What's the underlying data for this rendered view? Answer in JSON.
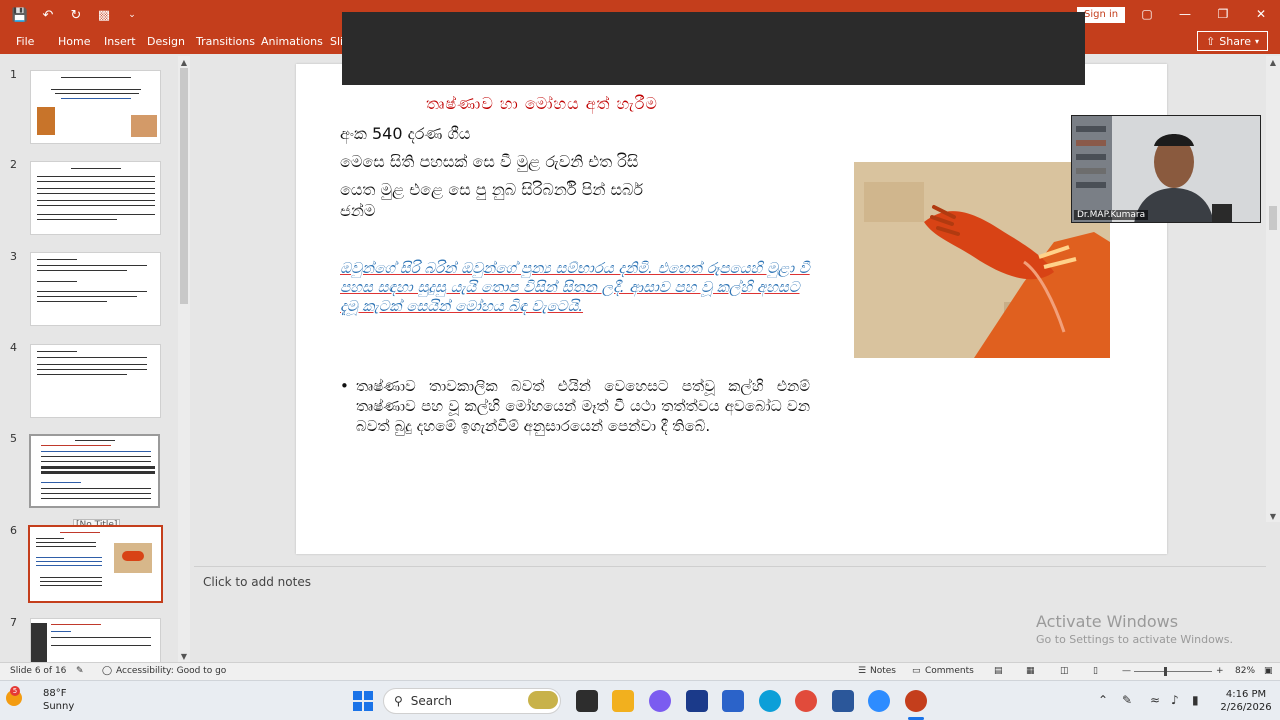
{
  "window": {
    "title_label": "Sign in",
    "share_label": "Share"
  },
  "ribbon": {
    "tabs": [
      {
        "label": "File"
      },
      {
        "label": "Home"
      },
      {
        "label": "Insert"
      },
      {
        "label": "Design"
      },
      {
        "label": "Transitions"
      },
      {
        "label": "Animations"
      },
      {
        "label": "Sli"
      }
    ]
  },
  "thumbnails": {
    "numbers": [
      "1",
      "2",
      "3",
      "4",
      "5",
      "6",
      "7"
    ],
    "tooltip": "[No Title]"
  },
  "slide": {
    "title": "තෘෂ්ණාව හා මෝහය අත් හැරීම",
    "lines": [
      "අංක 540 දරණ ගීය",
      "මෙසෙ සිති පහසක් සෙ වී මුළ රුවනි එත රිසි",
      "යෙත මුළ එළෙ සෙ පු නුබ සිරිබර්නි පින් සබර්",
      "ජන්ම"
    ],
    "blue_text": "ඔවුන්ගේ සිරි බරින් ඔවුන්ගේ පුන්‍ය සම්භාරය දනිමි. එහෙත් රූපයෙහි මුළා වී පහස සඳහා සුදුසු යැයි තොප විසින් සිතන ලදී. ආසාව පහ වූ කල්හි අහසට දැමූ කැටක් සෙයින් මෝහය බිඳ වැටෙයි.",
    "bullet_text": "තෘෂ්ණාව තාවකාලික බවත් එයින් වෙහෙසට පත්වූ කල්හි එනම් තෘෂ්ණාව පහ වූ කල්හි මෝහයෙන් මෑත් වී යථා තත්ත්වය අවබෝධ වන බවත් බුදු දහමේ ඉගැන්වීම් අනුසාරයෙන් පෙන්වා දී තිබේ."
  },
  "video": {
    "participant_name": "Dr.MAP.Kumara"
  },
  "notes": {
    "placeholder": "Click to add notes"
  },
  "watermark": {
    "line1": "Activate Windows",
    "line2": "Go to Settings to activate Windows."
  },
  "statusbar": {
    "slide_info": "Slide 6 of 16",
    "accessibility": "Accessibility: Good to go",
    "notes_label": "Notes",
    "comments_label": "Comments",
    "zoom_level": "82%"
  },
  "taskbar": {
    "temperature": "88°F",
    "condition": "Sunny",
    "weather_badge": "5",
    "search_label": "Search",
    "time": "4:16 PM",
    "date": "2/26/2026"
  }
}
